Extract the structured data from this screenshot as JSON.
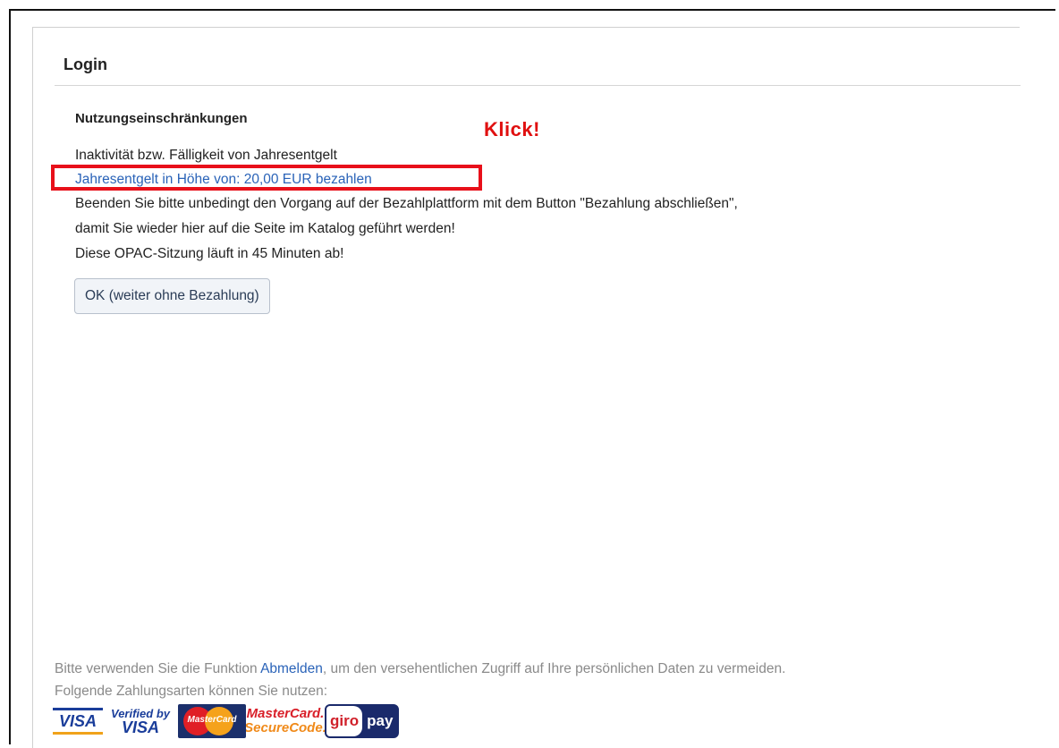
{
  "panel": {
    "title": "Login"
  },
  "notice": {
    "heading": "Nutzungseinschränkungen",
    "annotation": "Klick!",
    "line_inactivity": "Inaktivität bzw. Fälligkeit von Jahresentgelt",
    "pay_link": "Jahresentgelt in Höhe von: 20,00 EUR bezahlen",
    "line_finish": "Beenden Sie bitte unbedingt den Vorgang auf der Bezahlplattform mit dem Button \"Bezahlung abschließen\",",
    "line_return": "damit Sie wieder hier auf die Seite im Katalog geführt werden!",
    "line_session": "Diese OPAC-Sitzung läuft in 45 Minuten ab!",
    "ok_button": "OK (weiter ohne Bezahlung)"
  },
  "footer": {
    "logout_prefix": "Bitte verwenden Sie die Funktion ",
    "logout_link": "Abmelden",
    "logout_suffix": ", um den versehentlichen Zugriff auf Ihre persönlichen Daten zu vermeiden.",
    "payment_methods": "Folgende Zahlungsarten können Sie nutzen:",
    "logos": {
      "visa": "VISA",
      "verified_top": "Verified by",
      "verified_bottom": "VISA",
      "mastercard": "MasterCard",
      "securecode_top": "MasterCard.",
      "securecode_bottom": "SecureCode.",
      "giro": "giro",
      "pay": "pay"
    }
  },
  "colors": {
    "link": "#2a63b8",
    "highlight": "#e8101a",
    "annotation": "#e01010"
  }
}
